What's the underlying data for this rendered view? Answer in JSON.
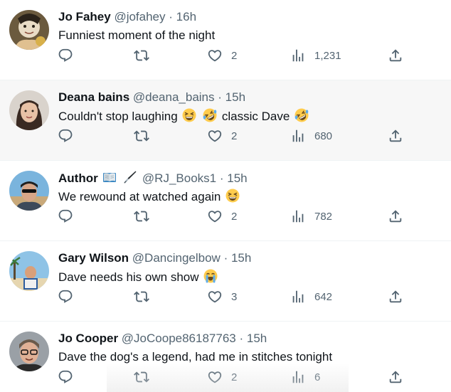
{
  "tweets": [
    {
      "name": "Jo Fahey",
      "handle": "@jofahey",
      "sep": "·",
      "time": "16h",
      "text": "Funniest moment of the night",
      "emojis": [],
      "replies": "",
      "retweets": "",
      "likes": "2",
      "views": "1,231"
    },
    {
      "name": "Deana bains",
      "handle": "@deana_bains",
      "sep": "·",
      "time": "15h",
      "text_parts": [
        "Couldn't stop laughing",
        "classic Dave"
      ],
      "emojis": [
        "grinning-squinting-face",
        "rolling-on-floor-laughing",
        "rolling-on-floor-laughing"
      ],
      "replies": "",
      "retweets": "",
      "likes": "2",
      "views": "680"
    },
    {
      "name": "Author",
      "name_emojis": [
        "open-book",
        "fountain-pen"
      ],
      "handle": "@RJ_Books1",
      "sep": "·",
      "time": "15h",
      "text": "We rewound at watched again",
      "emojis": [
        "grinning-squinting-face"
      ],
      "replies": "",
      "retweets": "",
      "likes": "2",
      "views": "782"
    },
    {
      "name": "Gary Wilson",
      "handle": "@Dancingelbow",
      "sep": "·",
      "time": "15h",
      "text": "Dave needs his own show",
      "emojis": [
        "loudly-crying-face"
      ],
      "replies": "",
      "retweets": "",
      "likes": "3",
      "views": "642"
    },
    {
      "name": "Jo Cooper",
      "handle": "@JoCoope86187763",
      "sep": "·",
      "time": "15h",
      "text": "Dave the dog's a legend, had me in stitches tonight",
      "emojis": [],
      "replies": "",
      "retweets": "",
      "likes": "2",
      "views": "6"
    }
  ],
  "colors": {
    "text": "#0f1419",
    "secondary": "#536471",
    "highlight_bg": "#f7f7f7",
    "divider": "#eff3f4"
  },
  "icons": {
    "reply": "reply-icon",
    "retweet": "retweet-icon",
    "like": "heart-icon",
    "views": "views-icon",
    "share": "share-icon"
  }
}
